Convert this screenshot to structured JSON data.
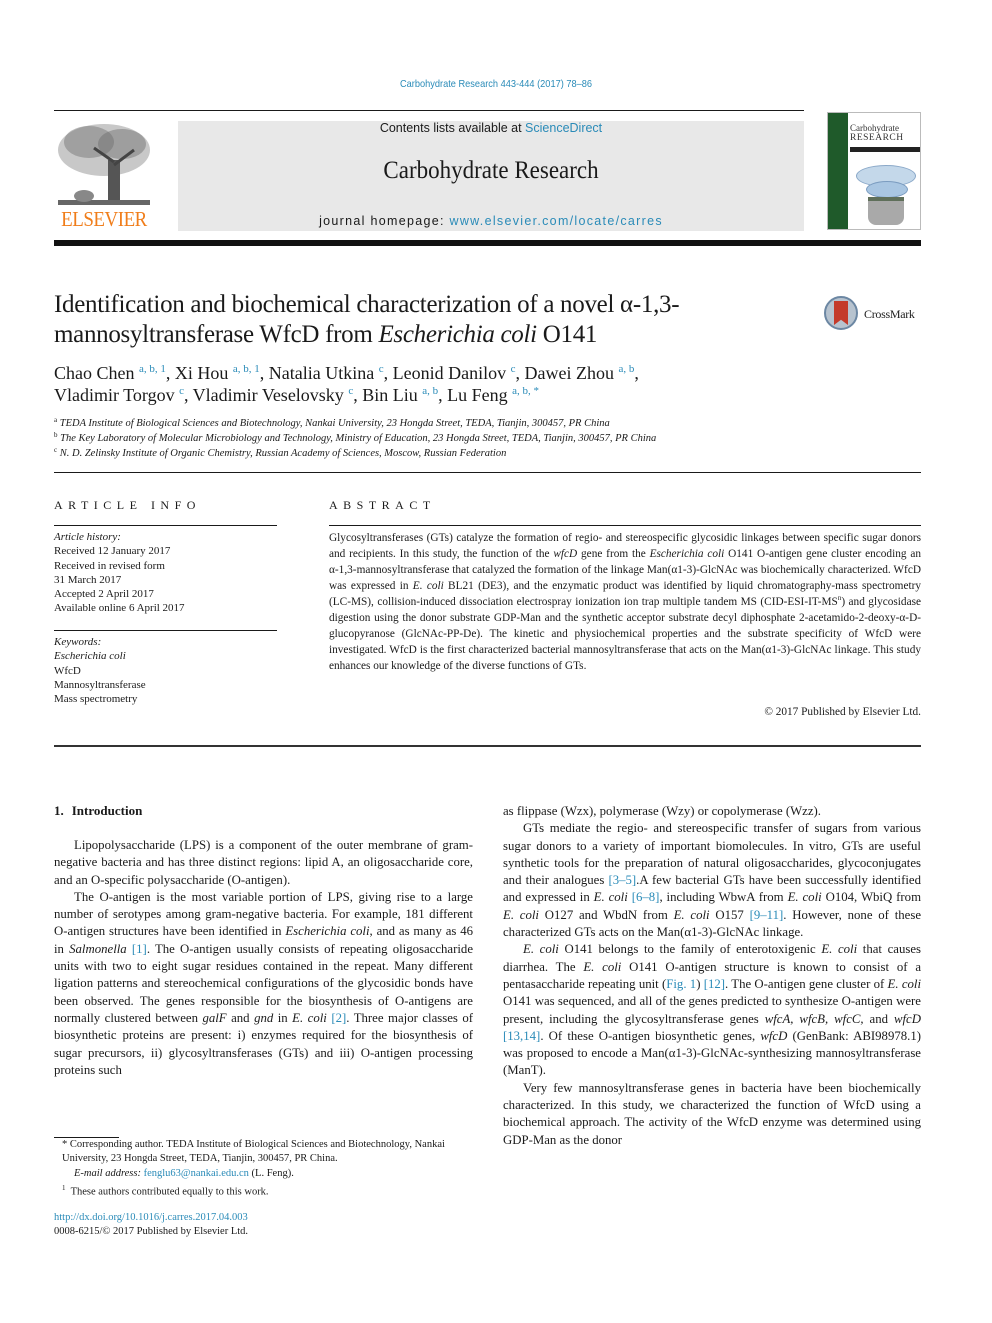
{
  "citation": "Carbohydrate Research 443-444 (2017) 78–86",
  "header": {
    "publisher_logo": "ELSEVIER",
    "contents_prefix": "Contents lists available at ",
    "contents_link": "ScienceDirect",
    "journal_title": "Carbohydrate Research",
    "homepage_prefix": "journal homepage: ",
    "homepage_link": "www.elsevier.com/locate/carres",
    "cover_title_line1": "Carbohydrate",
    "cover_title_line2": "RESEARCH",
    "crossmark_label": "CrossMark"
  },
  "article": {
    "title_part1": "Identification and biochemical characterization of a novel α-1,3-mannosyltransferase WfcD from ",
    "title_italic": "Escherichia coli",
    "title_part2": " O141",
    "authors": [
      {
        "name": "Chao Chen",
        "aff": "a, b, 1",
        "sep": ", "
      },
      {
        "name": "Xi Hou",
        "aff": "a, b, 1",
        "sep": ", "
      },
      {
        "name": "Natalia Utkina",
        "aff": "c",
        "sep": ", "
      },
      {
        "name": "Leonid Danilov",
        "aff": "c",
        "sep": ", "
      },
      {
        "name": "Dawei Zhou",
        "aff": "a, b",
        "sep": ","
      },
      {
        "name": "Vladimir Torgov",
        "aff": "c",
        "sep": ", "
      },
      {
        "name": "Vladimir Veselovsky",
        "aff": "c",
        "sep": ", "
      },
      {
        "name": "Bin Liu",
        "aff": "a, b",
        "sep": ", "
      },
      {
        "name": "Lu Feng",
        "aff": "a, b, *",
        "sep": ""
      }
    ],
    "affiliations": [
      {
        "key": "a",
        "text": "TEDA Institute of Biological Sciences and Biotechnology, Nankai University, 23 Hongda Street, TEDA, Tianjin, 300457, PR China"
      },
      {
        "key": "b",
        "text": "The Key Laboratory of Molecular Microbiology and Technology, Ministry of Education, 23 Hongda Street, TEDA, Tianjin, 300457, PR China"
      },
      {
        "key": "c",
        "text": "N. D. Zelinsky Institute of Organic Chemistry, Russian Academy of Sciences, Moscow, Russian Federation"
      }
    ]
  },
  "article_info": {
    "heading": "ARTICLE INFO",
    "history_label": "Article history:",
    "history": [
      "Received 12 January 2017",
      "Received in revised form",
      "31 March 2017",
      "Accepted 2 April 2017",
      "Available online 6 April 2017"
    ],
    "keywords_label": "Keywords:",
    "keywords": [
      "Escherichia coli",
      "WfcD",
      "Mannosyltransferase",
      "Mass spectrometry"
    ]
  },
  "abstract": {
    "heading": "ABSTRACT",
    "text_1": "Glycosyltransferases (GTs) catalyze the formation of regio- and stereospecific glycosidic linkages between specific sugar donors and recipients. In this study, the function of the ",
    "gene": "wfcD",
    "text_2": " gene from the ",
    "organism": "Escherichia coli",
    "text_3": " O141 O-antigen gene cluster encoding an α-1,3-mannosyltransferase that catalyzed the formation of the linkage Man(α1-3)-GlcNAc was biochemically characterized. WfcD was expressed in ",
    "ecoli": "E. coli",
    "text_4": " BL21 (DE3), and the enzymatic product was identified by liquid chromatography-mass spectrometry (LC-MS), collision-induced dissociation electrospray ionization ion trap multiple tandem MS (CID-ESI-IT-MS",
    "sup_n": "n",
    "text_5": ") and glycosidase digestion using the donor substrate GDP-Man and the synthetic acceptor substrate decyl diphosphate 2-acetamido-2-deoxy-α-D-glucopyranose (GlcNAc-PP-De). The kinetic and physiochemical properties and the substrate specificity of WfcD were investigated. WfcD is the first characterized bacterial mannosyltransferase that acts on the Man(α1-3)-GlcNAc linkage. This study enhances our knowledge of the diverse functions of GTs.",
    "copyright": "© 2017 Published by Elsevier Ltd."
  },
  "introduction": {
    "number": "1.",
    "heading": "Introduction",
    "p1": "Lipopolysaccharide (LPS) is a component of the outer membrane of gram-negative bacteria and has three distinct regions: lipid A, an oligosaccharide core, and an O-specific polysaccharide (O-antigen).",
    "p2_a": "The O-antigen is the most variable portion of LPS, giving rise to a large number of serotypes among gram-negative bacteria. For example, 181 different O-antigen structures have been identified in ",
    "p2_i1": "Escherichia coli",
    "p2_b": ", and as many as 46 in ",
    "p2_i2": "Salmonella",
    "p2_ref1": "[1]",
    "p2_c": ". The O-antigen usually consists of repeating oligosaccharide units with two to eight sugar residues contained in the repeat. Many different ligation patterns and stereochemical configurations of the glycosidic bonds have been observed. The genes responsible for the biosynthesis of O-antigens are normally clustered between ",
    "p2_i3": "galF",
    "p2_d": " and ",
    "p2_i4": "gnd",
    "p2_e": " in ",
    "p2_i5": "E. coli",
    "p2_ref2": "[2]",
    "p2_f": ". Three major classes of biosynthetic proteins are present: i) enzymes required for the biosynthesis of sugar precursors, ii) glycosyltransferases (GTs) and iii) O-antigen processing proteins such",
    "r_p0": "as flippase (Wzx), polymerase (Wzy) or copolymerase (Wzz).",
    "r_p1_a": "GTs mediate the regio- and stereospecific transfer of sugars from various sugar donors to a variety of important biomolecules. In vitro, GTs are useful synthetic tools for the preparation of natural oligosaccharides, glycoconjugates and their analogues ",
    "r_p1_ref1": "[3–5]",
    "r_p1_b": ".A few bacterial GTs have been successfully identified and expressed in ",
    "r_p1_i1": "E. coli",
    "r_p1_ref2": "[6–8]",
    "r_p1_c": ", including WbwA from ",
    "r_p1_i2": "E. coli",
    "r_p1_d": " O104, WbiQ from ",
    "r_p1_i3": "E. coli",
    "r_p1_e": " O127 and WbdN from ",
    "r_p1_i4": "E. coli",
    "r_p1_f": " O157 ",
    "r_p1_ref3": "[9–11]",
    "r_p1_g": ". However, none of these characterized GTs acts on the Man(α1-3)-GlcNAc linkage.",
    "r_p2_i1": "E. coli",
    "r_p2_a": " O141 belongs to the family of enterotoxigenic ",
    "r_p2_i2": "E. coli",
    "r_p2_b": " that causes diarrhea. The ",
    "r_p2_i3": "E. coli",
    "r_p2_c": " O141 O-antigen structure is known to consist of a pentasaccharide repeating unit (",
    "r_p2_fig": "Fig. 1",
    "r_p2_d": ") ",
    "r_p2_ref1": "[12]",
    "r_p2_e": ". The O-antigen gene cluster of ",
    "r_p2_i4": "E. coli",
    "r_p2_f": " O141 was sequenced, and all of the genes predicted to synthesize O-antigen were present, including the glycosyltransferase genes ",
    "r_p2_i5": "wfcA, wfcB, wfcC,",
    "r_p2_g": " and ",
    "r_p2_i6": "wfcD",
    "r_p2_ref2": "[13,14]",
    "r_p2_h": ". Of these O-antigen biosynthetic genes, ",
    "r_p2_i7": "wfcD",
    "r_p2_i": " (GenBank: ABI98978.1) was proposed to encode a Man(α1-3)-GlcNAc-synthesizing mannosyltransferase (ManT).",
    "r_p3": "Very few mannosyltransferase genes in bacteria have been biochemically characterized. In this study, we characterized the function of WfcD using a biochemical approach. The activity of the WfcD enzyme was determined using GDP-Man as the donor"
  },
  "footnotes": {
    "corresponding": "* Corresponding author. TEDA Institute of Biological Sciences and Biotechnology, Nankai University, 23 Hongda Street, TEDA, Tianjin, 300457, PR China.",
    "email_label": "E-mail address:",
    "email": "fenglu63@nankai.edu.cn",
    "email_suffix": " (L. Feng).",
    "equal_mark": "1",
    "equal": "These authors contributed equally to this work.",
    "doi": "http://dx.doi.org/10.1016/j.carres.2017.04.003",
    "issn": "0008-6215/© 2017 Published by Elsevier Ltd."
  }
}
